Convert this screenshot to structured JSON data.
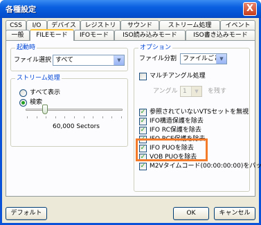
{
  "window": {
    "title": "各種設定",
    "close_label": "X"
  },
  "tabs_row1": [
    "CSS",
    "I/O",
    "デバイス",
    "レジストリ",
    "サウンド",
    "ストリーム処理",
    "イベント"
  ],
  "tabs_row2": [
    "一般",
    "FILEモード",
    "IFOモード",
    "ISO読み込みモード",
    "ISO書き込みモード"
  ],
  "active_tab": "FILEモード",
  "startup": {
    "group_title": "起動時",
    "file_select_label": "ファイル選択",
    "file_select_value": "すべて"
  },
  "stream": {
    "group_title": "ストリーム処理",
    "show_all_label": "すべて表示",
    "search_label": "検索",
    "search_selected": true,
    "sectors_label": "60,000 Sectors",
    "slider_fraction": 0.2
  },
  "options": {
    "group_title": "オプション",
    "split_label": "ファイル分割",
    "split_value": "ファイルごと",
    "multi_angle_label": "マルチアングル処理",
    "multi_angle_checked": false,
    "angle_label": "アングル",
    "angle_value": "1",
    "keep_label": "を残す",
    "checks": [
      {
        "label": "参照されていないVTSセットを無視",
        "checked": true
      },
      {
        "label": "IFO構造保護を除去",
        "checked": true
      },
      {
        "label": "IFO RC保護を除去",
        "checked": true
      },
      {
        "label": "IFO RCE保護を除去",
        "checked": true
      },
      {
        "label": "IFO PUOを除去",
        "checked": true
      },
      {
        "label": "VOB PUOを除去",
        "checked": true
      },
      {
        "label": "M2Vタイムコード(00:00:00:00)をパッチ",
        "checked": true
      }
    ]
  },
  "buttons": {
    "default": "デフォルト",
    "ok": "OK",
    "cancel": "キャンセル"
  },
  "colors": {
    "highlight": "#f47b2a",
    "group_title": "#0046d5"
  }
}
